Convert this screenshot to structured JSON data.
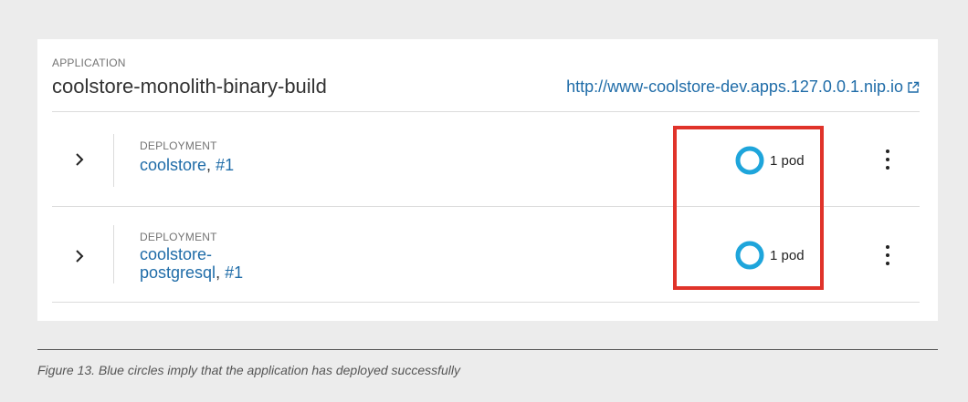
{
  "application": {
    "label": "APPLICATION",
    "name": "coolstore-monolith-binary-build",
    "url": "http://www-coolstore-dev.apps.127.0.0.1.nip.io",
    "url_icon": "external-link-icon"
  },
  "deployments": [
    {
      "label": "DEPLOYMENT",
      "name_line1": "coolstore",
      "name_line2": "",
      "separator": ", ",
      "version": "#1",
      "pods": "1 pod",
      "pod_status": "running",
      "pod_color": "#1ea5db"
    },
    {
      "label": "DEPLOYMENT",
      "name_line1": "coolstore-",
      "name_line2": "postgresql",
      "separator": ", ",
      "version": "#1",
      "pods": "1 pod",
      "pod_status": "running",
      "pod_color": "#1ea5db"
    }
  ],
  "caption": "Figure 13. Blue circles imply that the application has deployed successfully",
  "colors": {
    "link": "#1f6ca8",
    "highlight": "#e0332a",
    "background": "#ececec"
  }
}
